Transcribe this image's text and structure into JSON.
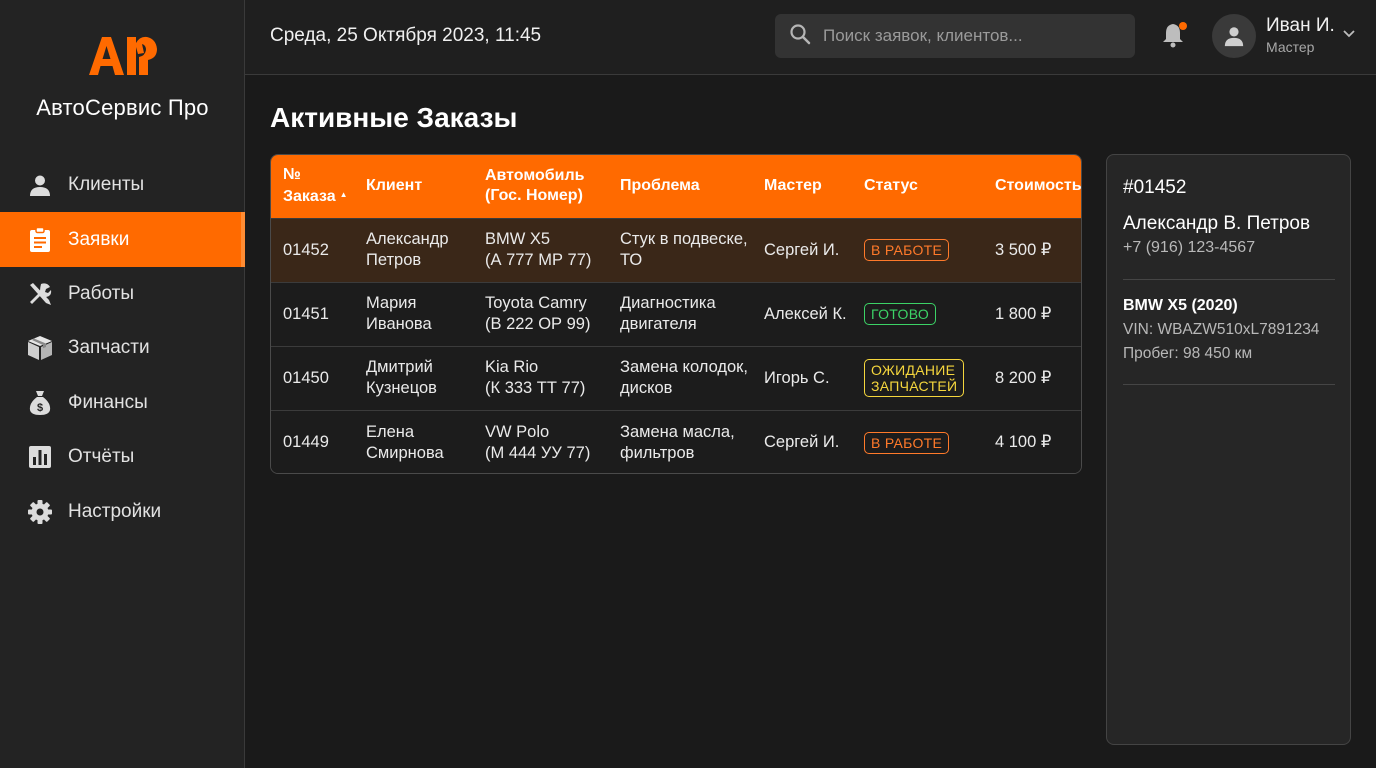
{
  "brand": {
    "logo_text": "АП",
    "name": "АвтоСервис Про",
    "accent": "#ff6a00"
  },
  "sidebar": {
    "items": [
      {
        "label": "Клиенты",
        "icon": "person-icon",
        "active": false
      },
      {
        "label": "Заявки",
        "icon": "clipboard-icon",
        "active": true
      },
      {
        "label": "Работы",
        "icon": "tools-icon",
        "active": false
      },
      {
        "label": "Запчасти",
        "icon": "box-icon",
        "active": false
      },
      {
        "label": "Финансы",
        "icon": "money-bag-icon",
        "active": false
      },
      {
        "label": "Отчёты",
        "icon": "bar-chart-icon",
        "active": false
      },
      {
        "label": "Настройки",
        "icon": "gear-icon",
        "active": false
      }
    ]
  },
  "topbar": {
    "datetime": "Среда, 25 Октября 2023, 11:45",
    "search_placeholder": "Поиск заявок, клиентов...",
    "user_name": "Иван И.",
    "user_role": "Мастер"
  },
  "main": {
    "title": "Активные Заказы",
    "columns": {
      "id_line1": "№",
      "id_line2": "Заказа",
      "client": "Клиент",
      "car_line1": "Автомобиль",
      "car_line2": "(Гос. Номер)",
      "problem": "Проблема",
      "master": "Мастер",
      "status": "Статус",
      "cost": "Стоимость"
    },
    "rows": [
      {
        "id": "01452",
        "client1": "Александр",
        "client2": "Петров",
        "car1": "BMW X5",
        "car2": "(А 777 МР 77)",
        "problem1": "Стук в подвеске,",
        "problem2": "ТО",
        "master": "Сергей И.",
        "status1": "В РАБОТЕ",
        "status2": "",
        "status_color": "orange",
        "cost": "3 500 ₽"
      },
      {
        "id": "01451",
        "client1": "Мария",
        "client2": "Иванова",
        "car1": "Toyota Camry",
        "car2": "(В 222 ОР 99)",
        "problem1": "Диагностика",
        "problem2": "двигателя",
        "master": "Алексей К.",
        "status1": "ГОТОВО",
        "status2": "",
        "status_color": "green",
        "cost": "1 800 ₽"
      },
      {
        "id": "01450",
        "client1": "Дмитрий",
        "client2": "Кузнецов",
        "car1": "Kia Rio",
        "car2": "(К 333 ТТ 77)",
        "problem1": "Замена колодок,",
        "problem2": "дисков",
        "master": "Игорь С.",
        "status1": "ОЖИДАНИЕ",
        "status2": "ЗАПЧАСТЕЙ",
        "status_color": "yellow",
        "cost": "8 200 ₽"
      },
      {
        "id": "01449",
        "client1": "Елена",
        "client2": "Смирнова",
        "car1": "VW Polo",
        "car2": "(М 444 УУ 77)",
        "problem1": "Замена масла,",
        "problem2": "фильтров",
        "master": "Сергей И.",
        "status1": "В РАБОТЕ",
        "status2": "",
        "status_color": "orange",
        "cost": "4 100 ₽"
      }
    ]
  },
  "detail": {
    "order_id": "#01452",
    "client_name": "Александр В. Петров",
    "phone": "+7 (916) 123-4567",
    "car": "BMW X5 (2020)",
    "vin": "VIN: WBAZW510xL7891234",
    "mileage": "Пробег: 98 450 км"
  }
}
